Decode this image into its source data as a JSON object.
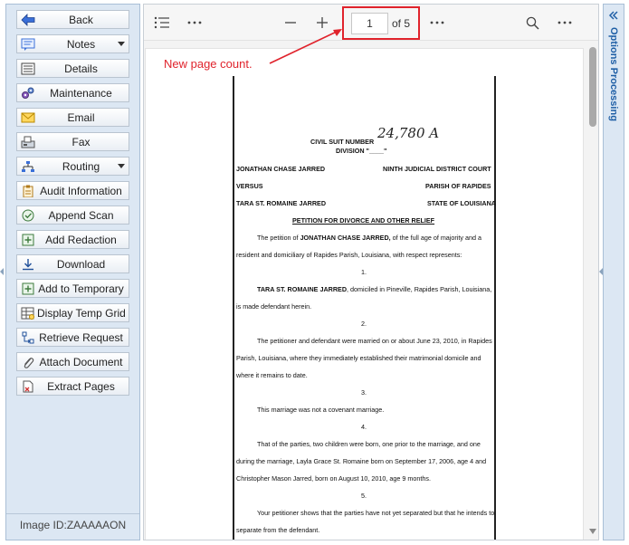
{
  "sidebar": {
    "buttons": [
      {
        "label": "Back",
        "icon": "back-arrow-icon"
      },
      {
        "label": "Notes",
        "icon": "notes-icon",
        "dropdown": true
      },
      {
        "label": "Details",
        "icon": "details-icon"
      },
      {
        "label": "Maintenance",
        "icon": "gears-icon"
      },
      {
        "label": "Email",
        "icon": "envelope-icon"
      },
      {
        "label": "Fax",
        "icon": "fax-icon"
      },
      {
        "label": "Routing",
        "icon": "routing-icon",
        "dropdown": true
      },
      {
        "label": "Audit Information",
        "icon": "clipboard-icon"
      },
      {
        "label": "Append Scan",
        "icon": "check-circle-icon"
      },
      {
        "label": "Add Redaction",
        "icon": "plus-box-icon"
      },
      {
        "label": "Download",
        "icon": "download-icon"
      },
      {
        "label": "Add to Temporary",
        "icon": "plus-box-icon"
      },
      {
        "label": "Display Temp Grid",
        "icon": "grid-icon"
      },
      {
        "label": "Retrieve Request",
        "icon": "retrieve-icon"
      },
      {
        "label": "Attach Document",
        "icon": "paperclip-icon"
      },
      {
        "label": "Extract Pages",
        "icon": "extract-pages-icon"
      }
    ],
    "image_id": "Image ID:ZAAAAAON"
  },
  "toolbar": {
    "page_value": "1",
    "page_of": "of 5",
    "icons": [
      "outline-list-icon",
      "more-horizontal-icon",
      "zoom-out-icon",
      "zoom-in-icon",
      "more-horizontal-icon",
      "search-icon",
      "more-horizontal-icon"
    ]
  },
  "annotation": "New page count.",
  "document": {
    "suit_number_label": "CIVIL SUIT NUMBER",
    "suit_number_handwritten": "24,780 A",
    "division_label": "DIVISION \"____\"",
    "plaintiff": "JONATHAN CHASE JARRED",
    "court": "NINTH JUDICIAL DISTRICT COURT",
    "versus": "VERSUS",
    "parish": "PARISH OF RAPIDES",
    "defendant": "TARA ST. ROMAINE JARRED",
    "state": "STATE OF LOUISIANA",
    "petition_title": "PETITION FOR DIVORCE AND OTHER RELIEF",
    "intro_line1_pre": "The petition of ",
    "intro_line1_bold": "JONATHAN CHASE JARRED,",
    "intro_line1_post": " of the full age of majority and a",
    "intro_line2": "resident and domiciliary of Rapides Parish, Louisiana, with respect represents:",
    "n1": "1.",
    "p1_bold": "TARA ST. ROMAINE JARRED",
    "p1_line1_post": ", domiciled in Pineville, Rapides Parish, Louisiana,",
    "p1_line2": "is made defendant herein.",
    "n2": "2.",
    "p2_line1": "The petitioner and defendant were married on or about June 23, 2010, in Rapides",
    "p2_line2": "Parish, Louisiana, where they immediately established their matrimonial domicile and",
    "p2_line3": "where it remains to date.",
    "n3": "3.",
    "p3_line1": "This marriage was not a covenant marriage.",
    "n4": "4.",
    "p4_line1": "That of the parties, two children were born, one prior to the marriage, and one",
    "p4_line2": "during the marriage, Layla Grace St. Romaine born on September 17, 2006, age 4 and",
    "p4_line3": "Christopher Mason Jarred, born on August 10, 2010, age 9 months.",
    "n5": "5.",
    "p5_line1": "Your petitioner shows that the parties have not yet separated but that he intends to",
    "p5_line2": "separate from the defendant."
  },
  "right_panel": {
    "title": "Options Processing",
    "collapse_icon": "double-chevron-left-icon"
  },
  "colors": {
    "sidebar_bg": "#dce7f3",
    "highlight": "#e0232c",
    "panel_title": "#1f5fa6"
  }
}
